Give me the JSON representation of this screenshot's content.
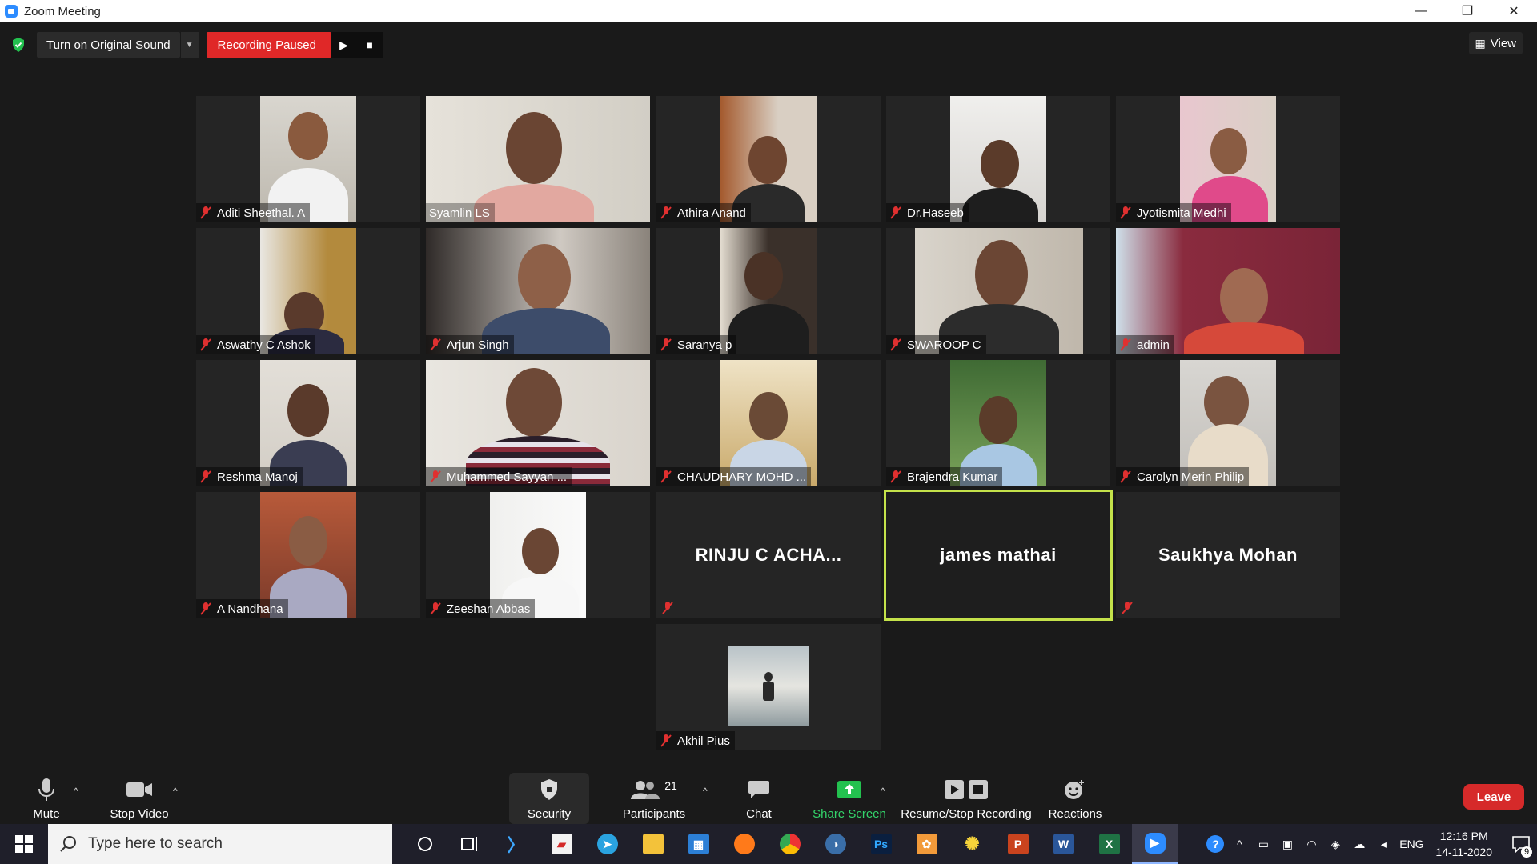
{
  "window": {
    "title": "Zoom Meeting",
    "controls": {
      "minimize": "—",
      "restore": "❐",
      "close": "✕"
    }
  },
  "top_bar": {
    "original_sound": "Turn on Original Sound",
    "recording_status": "Recording Paused",
    "view_label": "View"
  },
  "participants": [
    {
      "name": "Aditi Sheethal. A"
    },
    {
      "name": "Syamlin LS"
    },
    {
      "name": "Athira Anand"
    },
    {
      "name": "Dr.Haseeb"
    },
    {
      "name": "Jyotismita Medhi"
    },
    {
      "name": "Aswathy C Ashok"
    },
    {
      "name": "Arjun Singh"
    },
    {
      "name": "Saranya p"
    },
    {
      "name": "SWAROOP C"
    },
    {
      "name": "admin"
    },
    {
      "name": "Reshma Manoj"
    },
    {
      "name": "Muhammed Sayyan ..."
    },
    {
      "name": "CHAUDHARY MOHD ..."
    },
    {
      "name": "Brajendra Kumar"
    },
    {
      "name": "Carolyn Merin Philip"
    },
    {
      "name": "A Nandhana"
    },
    {
      "name": "Zeeshan Abbas"
    },
    {
      "name": "RINJU  C  ACHA..."
    },
    {
      "name": "james mathai"
    },
    {
      "name": "Saukhya Mohan"
    },
    {
      "name": "Akhil Pius"
    }
  ],
  "toolbar": {
    "mute": "Mute",
    "stop_video": "Stop Video",
    "security": "Security",
    "participants": "Participants",
    "participants_count": "21",
    "chat": "Chat",
    "share_screen": "Share Screen",
    "recording": "Resume/Stop Recording",
    "reactions": "Reactions",
    "leave": "Leave"
  },
  "taskbar": {
    "search_placeholder": "Type here to search",
    "language": "ENG",
    "time": "12:16 PM",
    "date": "14-11-2020",
    "notification_count": "9"
  },
  "colors": {
    "recording_red": "#e02828",
    "active_speaker": "#c4e24a",
    "share_green": "#33d46a",
    "leave_red": "#d62a2a"
  }
}
